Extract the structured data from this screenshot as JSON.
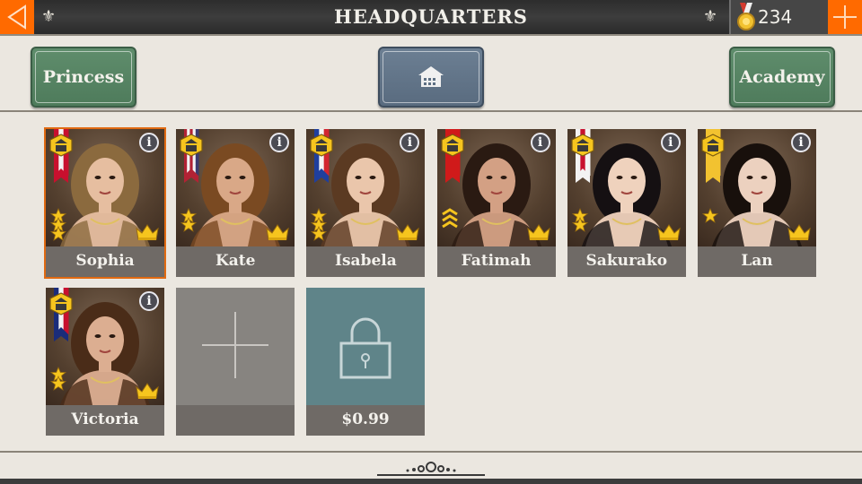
{
  "topbar": {
    "title": "HEADQUARTERS",
    "gold": "234",
    "back_icon": "triangle-left-icon",
    "add_icon": "plus-icon"
  },
  "header": {
    "princess_label": "Princess",
    "academy_label": "Academy",
    "center_icon": "house-icon"
  },
  "cards": [
    {
      "name": "Sophia",
      "flag": "austria",
      "stars": 3,
      "selected": true
    },
    {
      "name": "Kate",
      "flag": "usa",
      "stars": 2
    },
    {
      "name": "Isabela",
      "flag": "france",
      "stars": 3
    },
    {
      "name": "Fatimah",
      "flag": "ottoman",
      "stars": 0,
      "rank": "chevrons"
    },
    {
      "name": "Sakurako",
      "flag": "japan",
      "stars": 2
    },
    {
      "name": "Lan",
      "flag": "qing",
      "stars": 1
    },
    {
      "name": "Victoria",
      "flag": "uk",
      "stars": 2
    }
  ],
  "empty_slot": {
    "label": ""
  },
  "locked_slot": {
    "price": "$0.99"
  },
  "colors": {
    "accent_orange": "#ff6a00",
    "button_green": "#547f60",
    "button_slate": "#61748a",
    "background": "#ebe7e0",
    "namebar": "#6f6a66",
    "locked_slot": "#5f8489"
  }
}
